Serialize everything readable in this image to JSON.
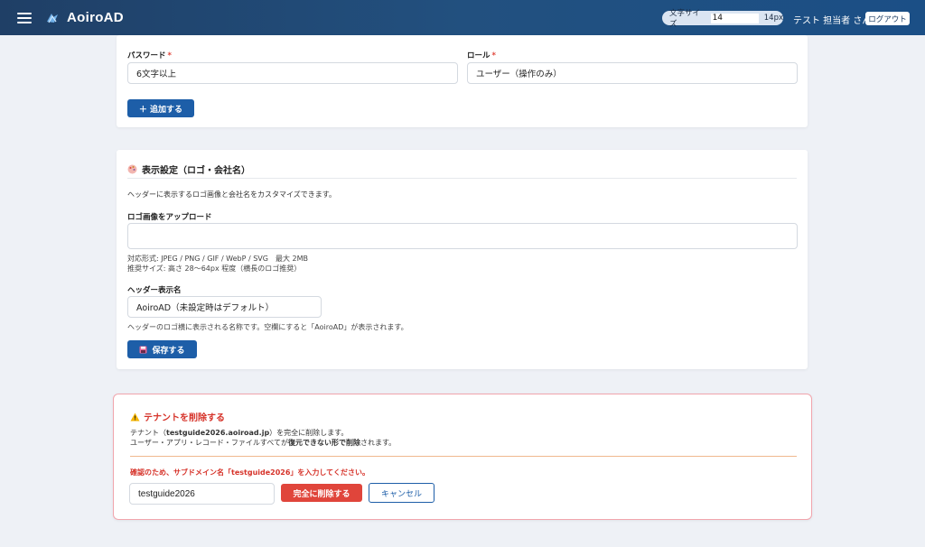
{
  "header": {
    "app_title": "AoiroAD",
    "font_size_label": "文字サイズ",
    "font_size_value": "14",
    "font_size_unit": "14px",
    "user_name": "テスト 担当者 さん",
    "logout_label": "ログアウト"
  },
  "user_form": {
    "password_label": "パスワード",
    "password_placeholder": "6文字以上",
    "role_label": "ロール",
    "role_value": "ユーザー（操作のみ）",
    "required_mark": "*",
    "add_button": "＋ 追加する"
  },
  "display_settings": {
    "title": "表示設定（ロゴ・会社名）",
    "description": "ヘッダーに表示するロゴ画像と会社名をカスタマイズできます。",
    "logo_upload_label": "ロゴ画像をアップロード",
    "logo_format_note": "対応形式: JPEG / PNG / GIF / WebP / SVG　最大 2MB",
    "logo_size_note": "推奨サイズ: 高さ 28〜64px 程度（横長のロゴ推奨）",
    "header_name_label": "ヘッダー表示名",
    "header_name_value": "AoiroAD（未設定時はデフォルト）",
    "header_name_note": "ヘッダーのロゴ横に表示される名称です。空欄にすると「AoiroAD」が表示されます。",
    "save_button": "保存する"
  },
  "delete_tenant": {
    "title": "テナントを削除する",
    "line1_prefix": "テナント（",
    "line1_domain": "testguide2026.aoiroad.jp",
    "line1_suffix": "）を完全に削除します。",
    "line2_prefix": "ユーザー・アプリ・レコード・ファイルすべてが",
    "line2_emph": "復元できない形で削除",
    "line2_suffix": "されます。",
    "confirm_prompt_prefix": "確認のため、サブドメイン名「",
    "confirm_prompt_domain": "testguide2026",
    "confirm_prompt_suffix": "」を入力してください。",
    "input_value": "testguide2026",
    "delete_button": "完全に削除する",
    "cancel_button": "キャンセル"
  },
  "colors": {
    "header_bg": "#1f3f66",
    "primary": "#1d5ea8",
    "danger": "#e0453b",
    "danger_border": "#f1a5ad"
  }
}
